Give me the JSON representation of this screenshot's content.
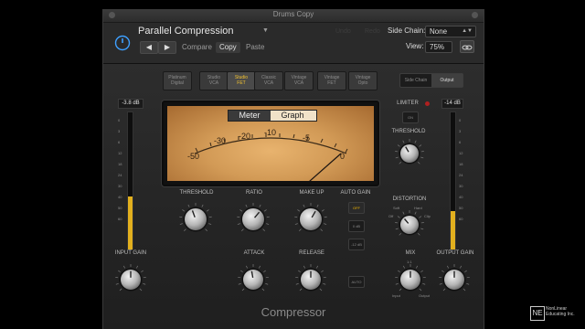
{
  "window": {
    "title": "Drums Copy"
  },
  "header": {
    "preset": "Parallel Compression",
    "back": "◀",
    "forward": "▶",
    "compare": "Compare",
    "copy": "Copy",
    "paste": "Paste",
    "undo": "Undo",
    "redo": "Redo",
    "sidechain_label": "Side Chain:",
    "sidechain_value": "None",
    "view_label": "View:",
    "view_value": "75%"
  },
  "models": [
    {
      "line1": "Platinum",
      "line2": "Digital"
    },
    {
      "line1": "Studio",
      "line2": "VCA"
    },
    {
      "line1": "Studio",
      "line2": "FET"
    },
    {
      "line1": "Classic",
      "line2": "VCA"
    },
    {
      "line1": "Vintage",
      "line2": "VCA"
    },
    {
      "line1": "Vintage",
      "line2": "FET"
    },
    {
      "line1": "Vintage",
      "line2": "Opto"
    }
  ],
  "active_model": "Studio FET",
  "meter": {
    "tab_meter": "Meter",
    "tab_graph": "Graph",
    "scale": [
      "-50",
      "-30",
      "-20",
      "-10",
      "-5",
      "0"
    ]
  },
  "output_toggle": {
    "sidechain": "Side Chain",
    "output": "Output"
  },
  "input_meter_value": "-3.8 dB",
  "output_meter_value": "-14 dB",
  "knobs": {
    "threshold": "THRESHOLD",
    "ratio": "RATIO",
    "makeup": "MAKE UP",
    "autogain": "AUTO GAIN",
    "attack": "ATTACK",
    "release": "RELEASE",
    "input_gain": "INPUT GAIN",
    "limiter": "LIMITER",
    "limiter_threshold": "THRESHOLD",
    "distortion": "DISTORTION",
    "mix": "MIX",
    "output_gain": "OUTPUT GAIN"
  },
  "autogain_buttons": {
    "off": "OFF",
    "zero": "0 dB",
    "minus12": "-12 dB"
  },
  "auto_button": "AUTO",
  "limiter_on": "ON",
  "distortion_labels": {
    "off": "Off",
    "soft": "Soft",
    "hard": "Hard",
    "clip": "Clip"
  },
  "mix_labels": {
    "input": "Input",
    "output": "Output",
    "ratio": "1:1"
  },
  "footer": {
    "title": "Compressor"
  },
  "watermark": {
    "line1": "NonLinear",
    "line2": "Educating Inc."
  }
}
